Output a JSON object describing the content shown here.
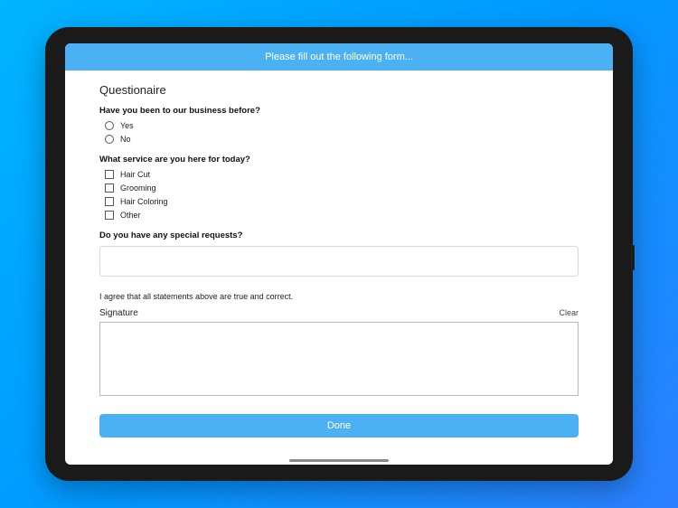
{
  "header": {
    "title": "Please fill out the following form..."
  },
  "form": {
    "section_title": "Questionaire",
    "q1": {
      "label": "Have you been to our business before?",
      "options": [
        "Yes",
        "No"
      ]
    },
    "q2": {
      "label": "What service are you here for today?",
      "options": [
        "Hair Cut",
        "Grooming",
        "Hair Coloring",
        "Other"
      ]
    },
    "q3": {
      "label": "Do you have any special requests?"
    },
    "agreement": "I agree that all statements above are true and correct.",
    "signature": {
      "label": "Signature",
      "clear": "Clear"
    },
    "done_label": "Done"
  }
}
